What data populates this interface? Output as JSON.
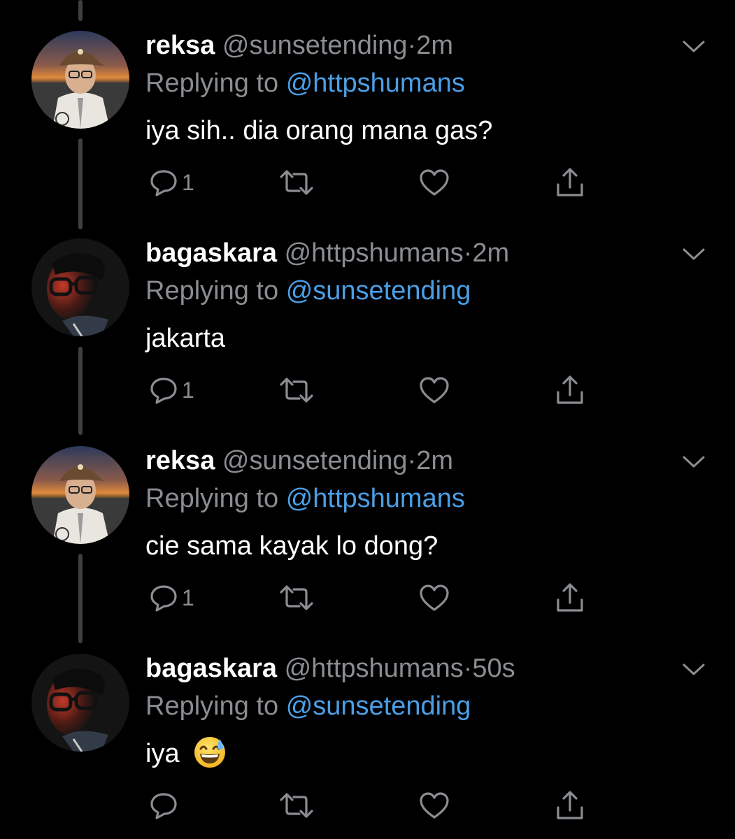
{
  "colors": {
    "background": "#000000",
    "text_primary": "#ffffff",
    "text_secondary": "#8a8d91",
    "mention": "#4a9fe6",
    "thread_line": "#3d3f42"
  },
  "reply_prefix": "Replying to",
  "tweets": [
    {
      "name": "reksa",
      "handle": "@sunsetending",
      "separator": "·",
      "time": "2m",
      "reply_to": "@httpshumans",
      "text": "iya sih.. dia orang mana gas?",
      "reply_count": "1",
      "avatar": "reksa-avatar",
      "icons": [
        "reply-icon",
        "retweet-icon",
        "like-icon",
        "share-icon",
        "caret-down-icon"
      ]
    },
    {
      "name": "bagaskara",
      "handle": "@httpshumans",
      "separator": "·",
      "time": "2m",
      "reply_to": "@sunsetending",
      "text": "jakarta",
      "reply_count": "1",
      "avatar": "bagaskara-avatar",
      "icons": [
        "reply-icon",
        "retweet-icon",
        "like-icon",
        "share-icon",
        "caret-down-icon"
      ]
    },
    {
      "name": "reksa",
      "handle": "@sunsetending",
      "separator": "·",
      "time": "2m",
      "reply_to": "@httpshumans",
      "text": "cie sama kayak lo dong?",
      "reply_count": "1",
      "avatar": "reksa-avatar",
      "icons": [
        "reply-icon",
        "retweet-icon",
        "like-icon",
        "share-icon",
        "caret-down-icon"
      ]
    },
    {
      "name": "bagaskara",
      "handle": "@httpshumans",
      "separator": "·",
      "time": "50s",
      "reply_to": "@sunsetending",
      "text": "iya",
      "text_emoji": "grinning-face-with-sweat-emoji",
      "reply_count": "",
      "avatar": "bagaskara-avatar",
      "icons": [
        "reply-icon",
        "retweet-icon",
        "like-icon",
        "share-icon",
        "caret-down-icon"
      ]
    }
  ]
}
